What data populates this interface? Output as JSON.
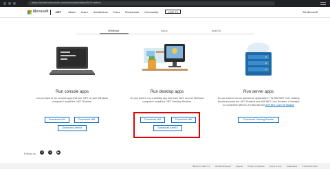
{
  "browser": {
    "url": "https://dotnet.microsoft.com/download/dotnet/5.0/runtime"
  },
  "header": {
    "brand": "Microsoft",
    "product": ".NET",
    "nav": [
      "About",
      "Learn",
      "Architecture",
      "Docs",
      "Downloads",
      "Community"
    ],
    "cta": "LIVE TV",
    "account": "All Microsoft"
  },
  "tabs": [
    "Windows",
    "Linux",
    "macOS"
  ],
  "columns": [
    {
      "title": "Run console apps",
      "description": "Do you want to run console apps that use .NET on your Windows computer? Install the .NET Runtime.",
      "buttons": [
        "Download x64",
        "Download x86",
        "Download Arm64"
      ]
    },
    {
      "title": "Run desktop apps",
      "description": "Do you want to run a desktop app that uses .NET on your Windows computer? Install the .NET Desktop Runtime.",
      "buttons": [
        "Download x64",
        "Download x86",
        "Download Arm64"
      ]
    },
    {
      "title": "Run server apps",
      "description": "Do you want to run an web/server application? The ASP.NET Core Hosting Bundle includes the .NET Runtime and ASP.NET Core Runtime. If installed on a machine with IIS, it'll also add the",
      "link": "ASP.NET Core IIS Module",
      "buttons": [
        "Download Hosting Bundle"
      ]
    }
  ],
  "social": {
    "label": "Follow us",
    "icons": [
      "facebook-icon",
      "twitter-icon",
      "youtube-icon"
    ]
  },
  "footer": {
    "links": [
      "Blazor for .NET 5.0",
      "Contact Microsoft",
      "Support",
      "Privacy & Cookies",
      "Terms of Use",
      "Trademarks",
      "© Microsoft 2021"
    ]
  },
  "colors": {
    "accent": "#0067b8",
    "highlight": "#e00000"
  }
}
